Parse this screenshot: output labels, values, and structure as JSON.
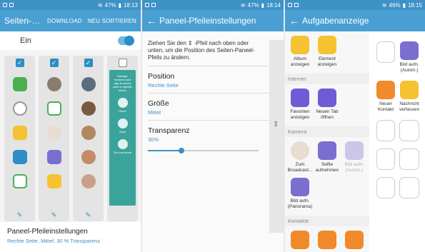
{
  "colors": {
    "accent": "#4a9fd2",
    "statusbar": "#3e92c6",
    "link": "#3e8fc6"
  },
  "screen1": {
    "status": {
      "battery": "47%",
      "time": "18:13"
    },
    "title": "Seiten-Pa...",
    "action_download": "DOWNLOAD",
    "action_sort": "NEU SORTIEREN",
    "toggle_label": "Ein",
    "panel_teal_text": "Manage functions and app shortcuts used in specific states",
    "panel_teal_items": [
      "Home",
      "Work",
      "Out and about"
    ],
    "footer_title": "Paneel-Pfeileinstellungen",
    "footer_subtitle": "Rechte Seite, Mittel, 30 % Transparenz"
  },
  "screen2": {
    "status": {
      "battery": "47%",
      "time": "18:14"
    },
    "title": "Paneel-Pfeileinstellungen",
    "description": "Ziehen Sie den ⇕ -Pfeil nach oben oder unten, um die Position des Seiten-Paneel-Pfeils zu ändern.",
    "position_label": "Position",
    "position_value": "Rechte Seite",
    "size_label": "Größe",
    "size_value": "Mittel",
    "transparency_label": "Transparenz",
    "transparency_value": "30%",
    "transparency_fraction": 0.3
  },
  "screen3": {
    "status": {
      "battery": "46%",
      "time": "18:15"
    },
    "title": "Aufgabenanzeige",
    "top_items": [
      {
        "label": "Album anzeigen",
        "color": "#f5c332"
      },
      {
        "label": "Element anzeigen",
        "color": "#f5c332"
      }
    ],
    "section_internet": "Internet",
    "internet_items": [
      {
        "label": "Favoriten anzeigen",
        "color": "#6f5bd6"
      },
      {
        "label": "Neuen Tab öffnen",
        "color": "#6f5bd6"
      }
    ],
    "section_camera": "Kamera",
    "camera_items": [
      {
        "label": "Zum Broadcast...",
        "color": "#e8ddd0"
      },
      {
        "label": "Selfie aufnehmen",
        "color": "#7a6fd0"
      },
      {
        "label": "Bild aufn. (Autom.)",
        "color": "#c9c4ee"
      },
      {
        "label": "Bild aufn. (Panorama)",
        "color": "#7a6fd0"
      }
    ],
    "section_contacts": "Kontakte",
    "right_items": [
      {
        "label": "Bild aufn. (Autom.)",
        "color": "#7a6fd0"
      },
      {
        "label": "Neuer Kontakt",
        "color": "#f08a2a"
      },
      {
        "label": "Nachricht verfassen",
        "color": "#f5c332"
      }
    ]
  }
}
